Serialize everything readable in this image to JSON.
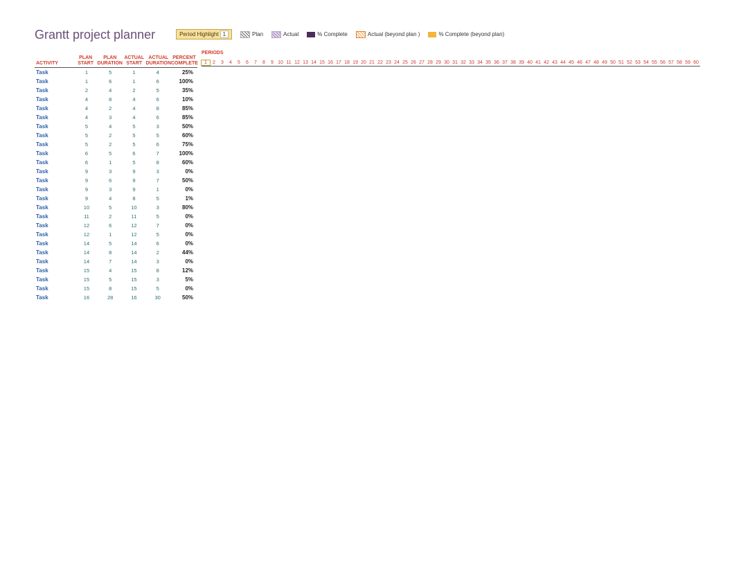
{
  "title": "Grantt project planner",
  "period_highlight": {
    "label": "Period Highlight",
    "value": "1"
  },
  "legend": {
    "plan": "Plan",
    "actual": "Actual",
    "pc": "% Complete",
    "abp": "Actual (beyond plan )",
    "pcbp": "% Complete (beyond plan)"
  },
  "headers": {
    "activity": "ACTIVITY",
    "plan_start": "PLAN START",
    "plan_dur": "PLAN DURATION",
    "act_start": "ACTUAL START",
    "act_dur": "ACTUAL DURATION",
    "pct": "PERCENT COMPLETE",
    "periods": "PERIODS"
  },
  "periods_max": 60,
  "tasks": [
    {
      "name": "Task",
      "ps": "1",
      "pd": "5",
      "as": "1",
      "ad": "4",
      "pc": "25%"
    },
    {
      "name": "Task",
      "ps": "1",
      "pd": "6",
      "as": "1",
      "ad": "6",
      "pc": "100%"
    },
    {
      "name": "Task",
      "ps": "2",
      "pd": "4",
      "as": "2",
      "ad": "5",
      "pc": "35%"
    },
    {
      "name": "Task",
      "ps": "4",
      "pd": "8",
      "as": "4",
      "ad": "6",
      "pc": "10%"
    },
    {
      "name": "Task",
      "ps": "4",
      "pd": "2",
      "as": "4",
      "ad": "8",
      "pc": "85%"
    },
    {
      "name": "Task",
      "ps": "4",
      "pd": "3",
      "as": "4",
      "ad": "6",
      "pc": "85%"
    },
    {
      "name": "Task",
      "ps": "5",
      "pd": "4",
      "as": "5",
      "ad": "3",
      "pc": "50%"
    },
    {
      "name": "Task",
      "ps": "5",
      "pd": "2",
      "as": "5",
      "ad": "5",
      "pc": "60%"
    },
    {
      "name": "Task",
      "ps": "5",
      "pd": "2",
      "as": "5",
      "ad": "6",
      "pc": "75%"
    },
    {
      "name": "Task",
      "ps": "6",
      "pd": "5",
      "as": "6",
      "ad": "7",
      "pc": "100%"
    },
    {
      "name": "Task",
      "ps": "6",
      "pd": "1",
      "as": "5",
      "ad": "8",
      "pc": "60%"
    },
    {
      "name": "Task",
      "ps": "9",
      "pd": "3",
      "as": "9",
      "ad": "3",
      "pc": "0%"
    },
    {
      "name": "Task",
      "ps": "9",
      "pd": "6",
      "as": "9",
      "ad": "7",
      "pc": "50%"
    },
    {
      "name": "Task",
      "ps": "9",
      "pd": "3",
      "as": "9",
      "ad": "1",
      "pc": "0%"
    },
    {
      "name": "Task",
      "ps": "9",
      "pd": "4",
      "as": "8",
      "ad": "5",
      "pc": "1%"
    },
    {
      "name": "Task",
      "ps": "10",
      "pd": "5",
      "as": "10",
      "ad": "3",
      "pc": "80%"
    },
    {
      "name": "Task",
      "ps": "11",
      "pd": "2",
      "as": "11",
      "ad": "5",
      "pc": "0%"
    },
    {
      "name": "Task",
      "ps": "12",
      "pd": "6",
      "as": "12",
      "ad": "7",
      "pc": "0%"
    },
    {
      "name": "Task",
      "ps": "12",
      "pd": "1",
      "as": "12",
      "ad": "5",
      "pc": "0%"
    },
    {
      "name": "Task",
      "ps": "14",
      "pd": "5",
      "as": "14",
      "ad": "6",
      "pc": "0%"
    },
    {
      "name": "Task",
      "ps": "14",
      "pd": "8",
      "as": "14",
      "ad": "2",
      "pc": "44%"
    },
    {
      "name": "Task",
      "ps": "14",
      "pd": "7",
      "as": "14",
      "ad": "3",
      "pc": "0%"
    },
    {
      "name": "Task",
      "ps": "15",
      "pd": "4",
      "as": "15",
      "ad": "8",
      "pc": "12%"
    },
    {
      "name": "Task",
      "ps": "15",
      "pd": "5",
      "as": "15",
      "ad": "3",
      "pc": "5%"
    },
    {
      "name": "Task",
      "ps": "15",
      "pd": "8",
      "as": "15",
      "ad": "5",
      "pc": "0%"
    },
    {
      "name": "Task",
      "ps": "16",
      "pd": "28",
      "as": "16",
      "ad": "30",
      "pc": "50%"
    }
  ]
}
